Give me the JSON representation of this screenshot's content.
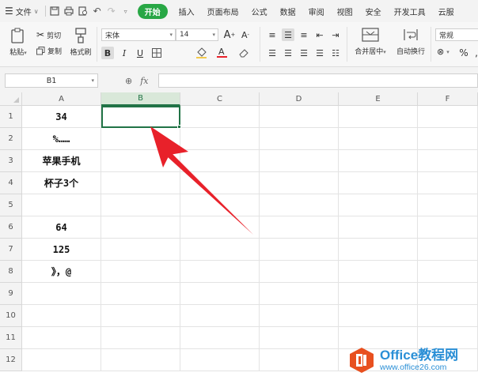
{
  "menu": {
    "file_label": "文件",
    "tabs": [
      "开始",
      "插入",
      "页面布局",
      "公式",
      "数据",
      "审阅",
      "视图",
      "安全",
      "开发工具",
      "云服"
    ],
    "active_tab": "开始"
  },
  "ribbon": {
    "paste": "粘贴",
    "cut": "剪切",
    "copy": "复制",
    "format_painter": "格式刷",
    "font_name": "宋体",
    "font_size": "14",
    "bold": "B",
    "italic": "I",
    "underline": "U",
    "merge_center": "合并居中",
    "wrap_text": "自动换行",
    "number_format": "常规"
  },
  "formula_bar": {
    "name_box": "B1",
    "fx": "fx",
    "value": ""
  },
  "grid": {
    "columns": [
      "A",
      "B",
      "C",
      "D",
      "E",
      "F"
    ],
    "selected_column": "B",
    "rows": [
      "1",
      "2",
      "3",
      "4",
      "5",
      "6",
      "7",
      "8",
      "9",
      "10",
      "11",
      "12"
    ],
    "column_a": [
      "34",
      "%……",
      "苹果手机",
      "杯子3个",
      "",
      "64",
      "125",
      "》，@",
      "",
      "",
      "",
      ""
    ],
    "active_cell": "B1"
  },
  "watermark": {
    "title_en": "Office",
    "title_cn": "教程网",
    "url": "www.office26.com"
  },
  "colors": {
    "accent_green": "#217346",
    "tab_green": "#28a745",
    "arrow_red": "#e8212a",
    "watermark_blue": "#2a8fd6",
    "logo_orange": "#e8501f"
  }
}
